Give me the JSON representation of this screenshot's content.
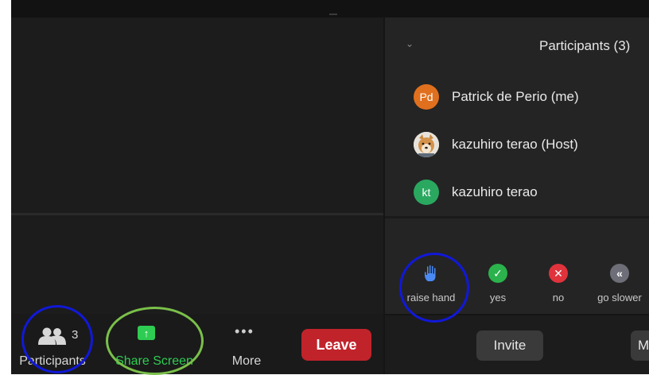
{
  "toolbar": {
    "participants": {
      "icon": "participants-icon",
      "count": "3",
      "label": "Participants"
    },
    "share": {
      "icon": "share-screen-arrow-icon",
      "glyph": "↑",
      "label": "Share Screen",
      "color": "#2ecc52"
    },
    "more": {
      "icon": "more-dots-icon",
      "glyph": "•••",
      "label": "More"
    },
    "leave": {
      "label": "Leave",
      "color": "#c1232b"
    }
  },
  "panel": {
    "title": "Participants (3)",
    "chevron": "⌄",
    "participants": [
      {
        "initials": "Pd",
        "name": "Patrick de Perio (me)",
        "avatar_color": "#e0701e"
      },
      {
        "initials": "",
        "name": "kazuhiro terao (Host)",
        "avatar": "dog-photo"
      },
      {
        "initials": "kt",
        "name": "kazuhiro terao",
        "avatar_color": "#2aa860"
      }
    ],
    "reactions": [
      {
        "icon": "raise-hand-icon",
        "glyph": "✋",
        "label": "raise hand",
        "color": "#4a8af4"
      },
      {
        "icon": "check-icon",
        "glyph": "✓",
        "label": "yes",
        "color": "#2bb24c"
      },
      {
        "icon": "x-icon",
        "glyph": "✕",
        "label": "no",
        "color": "#e0333c"
      },
      {
        "icon": "go-slower-icon",
        "glyph": "«",
        "label": "go slower",
        "color": "#6e6e78"
      }
    ],
    "invite_label": "Invite",
    "mute_label": "M"
  },
  "annotations": {
    "blue": "#1118d8",
    "green": "#7ac04a"
  }
}
